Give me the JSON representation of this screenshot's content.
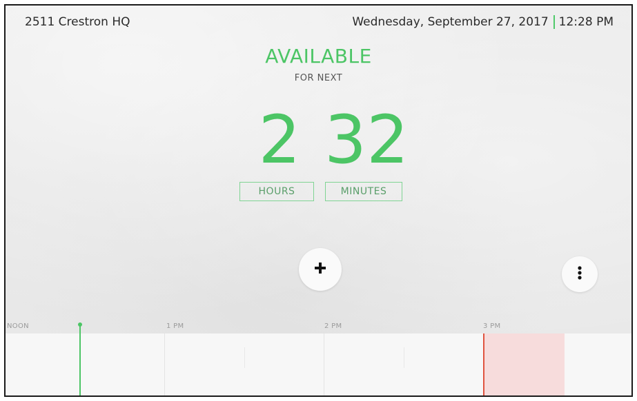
{
  "header": {
    "room_name": "2511 Crestron HQ",
    "date": "Wednesday, September 27, 2017",
    "time": "12:28 PM"
  },
  "status": {
    "label": "AVAILABLE",
    "sublabel": "FOR NEXT",
    "color": "#4cc565"
  },
  "countdown": {
    "hours": "2",
    "minutes": "32",
    "hours_label": "HOURS",
    "minutes_label": "MINUTES"
  },
  "actions": {
    "add_icon": "plus-icon",
    "more_icon": "vertical-dots-icon"
  },
  "timeline": {
    "labels": [
      "NOON",
      "1 PM",
      "2 PM",
      "3 PM"
    ],
    "now_color": "#4cc565",
    "booked_color": "#f7dcdc",
    "booked_edge_color": "#e0533f"
  }
}
